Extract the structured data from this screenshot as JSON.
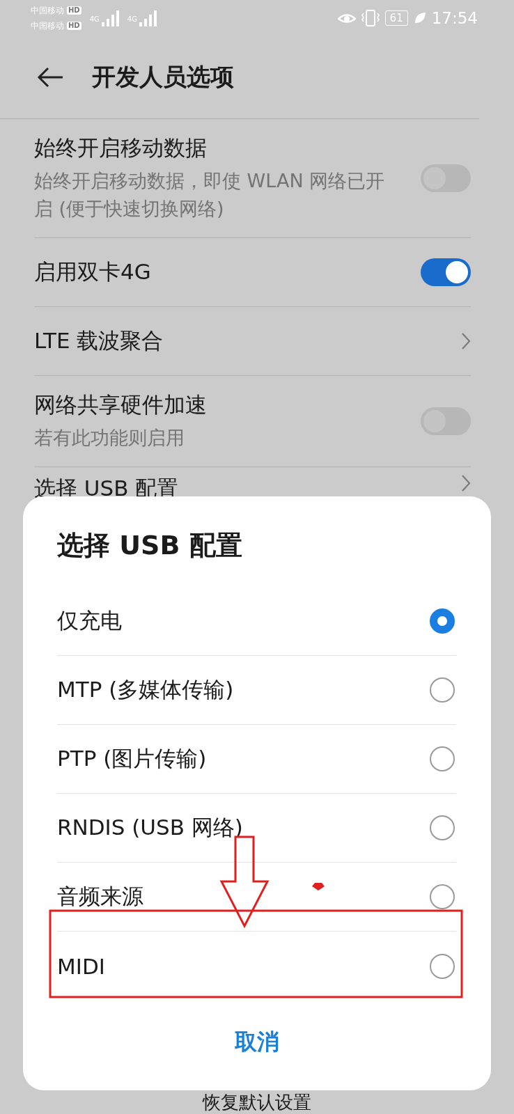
{
  "status_bar": {
    "carriers": [
      {
        "name": "中国移动",
        "badge": "HD",
        "network": "4G"
      },
      {
        "name": "中国移动",
        "badge": "HD",
        "network": "4G"
      }
    ],
    "battery": "61",
    "time": "17:54"
  },
  "header": {
    "title": "开发人员选项"
  },
  "settings": [
    {
      "kind": "toggle",
      "title": "始终开启移动数据",
      "subtitle": "始终开启移动数据，即使 WLAN 网络已开启 (便于快速切换网络)",
      "on": false
    },
    {
      "kind": "toggle",
      "title": "启用双卡4G",
      "on": true
    },
    {
      "kind": "link",
      "title": "LTE 载波聚合"
    },
    {
      "kind": "toggle",
      "title": "网络共享硬件加速",
      "subtitle": "若有此功能则启用",
      "on": false
    },
    {
      "kind": "link",
      "title": "选择 USB 配置"
    }
  ],
  "footer_text": "恢复默认设置",
  "dialog": {
    "title": "选择 USB 配置",
    "options": [
      {
        "label": "仅充电",
        "selected": true
      },
      {
        "label": "MTP (多媒体传输)",
        "selected": false
      },
      {
        "label": "PTP (图片传输)",
        "selected": false
      },
      {
        "label": "RNDIS (USB 网络)",
        "selected": false
      },
      {
        "label": "音频来源",
        "selected": false
      },
      {
        "label": "MIDI",
        "selected": false
      }
    ],
    "cancel": "取消"
  }
}
